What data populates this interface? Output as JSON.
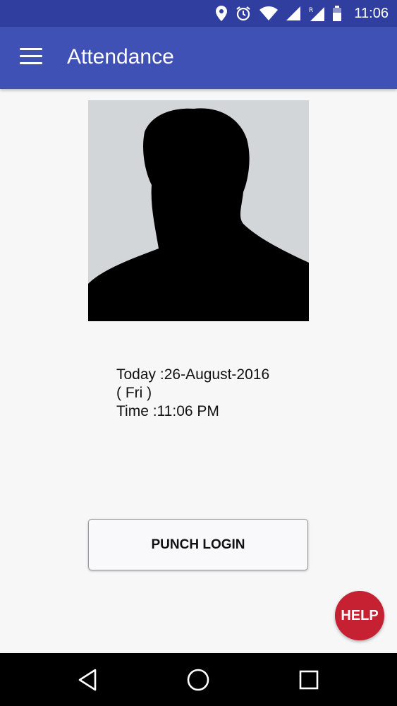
{
  "status_bar": {
    "time": "11:06",
    "icons": [
      "location-icon",
      "alarm-icon",
      "wifi-icon",
      "signal-icon",
      "roaming-signal-icon",
      "battery-icon"
    ]
  },
  "app_bar": {
    "title": "Attendance",
    "menu_icon": "hamburger-menu-icon",
    "color": "#3f51b5",
    "status_color": "#303f9f"
  },
  "profile": {
    "photo": "person-silhouette"
  },
  "info": {
    "date_line": "Today :26-August-2016",
    "day_line": "( Fri )",
    "time_line": "Time :11:06 PM"
  },
  "actions": {
    "punch_label": "PUNCH LOGIN",
    "help_label": "HELP",
    "help_color": "#c62033"
  },
  "nav_bar": {
    "icons": [
      "back-icon",
      "home-icon",
      "recents-icon"
    ]
  }
}
